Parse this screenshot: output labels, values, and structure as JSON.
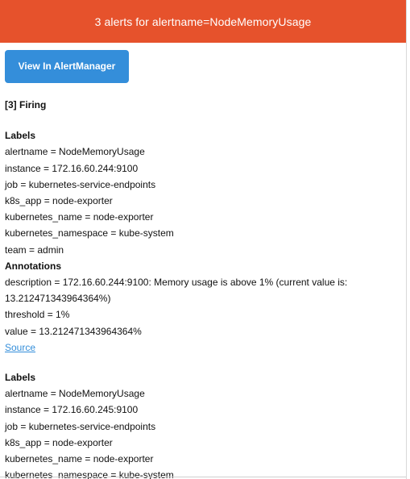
{
  "header": {
    "title": "3 alerts for alertname=NodeMemoryUsage"
  },
  "button": {
    "label": "View In AlertManager"
  },
  "firing_label": "[3] Firing",
  "alerts": [
    {
      "labels_title": "Labels",
      "labels": [
        "alertname = NodeMemoryUsage",
        "instance = 172.16.60.244:9100",
        "job = kubernetes-service-endpoints",
        "k8s_app = node-exporter",
        "kubernetes_name = node-exporter",
        "kubernetes_namespace = kube-system",
        "team = admin"
      ],
      "annotations_title": "Annotations",
      "annotations": [
        "description = 172.16.60.244:9100: Memory usage is above 1% (current value is: 13.212471343964364%)",
        "threshold = 1%",
        "value = 13.212471343964364%"
      ],
      "source_label": "Source"
    },
    {
      "labels_title": "Labels",
      "labels": [
        "alertname = NodeMemoryUsage",
        "instance = 172.16.60.245:9100",
        "job = kubernetes-service-endpoints",
        "k8s_app = node-exporter",
        "kubernetes_name = node-exporter",
        "kubernetes_namespace = kube-system"
      ]
    }
  ],
  "colors": {
    "header_bg": "#E6522C",
    "button_bg": "#348EDA",
    "link": "#348EDA"
  }
}
